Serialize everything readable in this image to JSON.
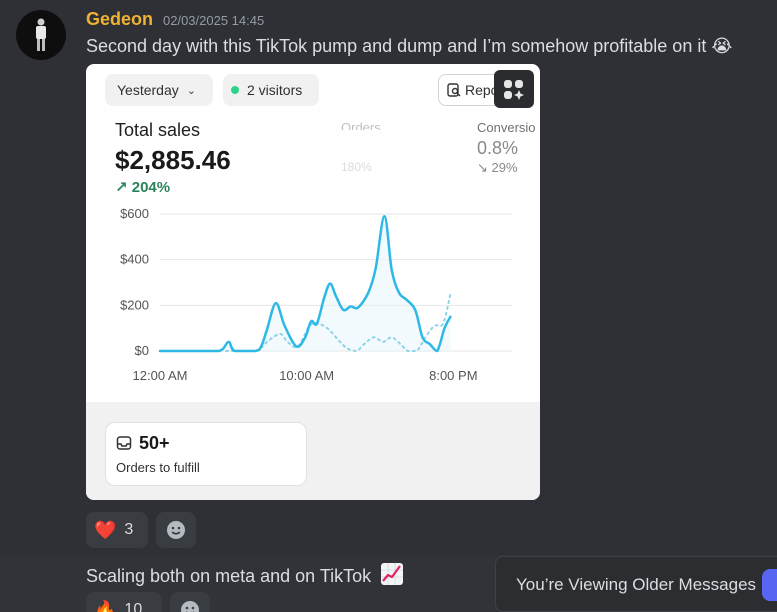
{
  "message1": {
    "author": "Gedeon",
    "timestamp": "02/03/2025 14:45",
    "text": "Second day with this TikTok pump and dump and I’m somehow profitable on it",
    "emoji": "😭"
  },
  "attachment": {
    "date_filter": "Yesterday",
    "visitors": "2 visitors",
    "report_label": "Repo",
    "total_sales_label": "Total sales",
    "total_sales_value": "$2,885.46",
    "total_sales_change": "204%",
    "orders_label": "Orders",
    "orders_change": "180%",
    "conversion_label": "Conversio",
    "conversion_value": "0.8%",
    "conversion_change": "29%",
    "fulfill_count": "50+",
    "fulfill_label": "Orders to fulfill",
    "accent_green": "#29845a",
    "line_color": "#2eb8e6"
  },
  "chart_data": {
    "type": "line",
    "title": "",
    "x_ticks": [
      "12:00 AM",
      "10:00 AM",
      "8:00 PM"
    ],
    "y_ticks": [
      "$600",
      "$400",
      "$200",
      "$0"
    ],
    "ylim": [
      0,
      600
    ],
    "series": [
      {
        "name": "",
        "style": "solid",
        "x": [
          0,
          1,
          2,
          3,
          4,
          5,
          6,
          7,
          8,
          9,
          10,
          11,
          12,
          13,
          14,
          15,
          16,
          17,
          18,
          19,
          20,
          21,
          22,
          23,
          24
        ],
        "values": [
          0,
          0,
          0,
          0,
          0,
          0,
          0,
          0,
          0,
          0,
          0,
          0,
          0,
          0,
          0,
          0,
          0,
          0,
          0,
          0,
          0,
          0,
          0,
          0,
          0
        ]
      }
    ],
    "solid_points": [
      [
        0,
        0
      ],
      [
        3,
        0
      ],
      [
        4,
        0
      ],
      [
        4.3,
        10
      ],
      [
        4.7,
        40
      ],
      [
        5.1,
        0
      ],
      [
        6.5,
        0
      ],
      [
        6.9,
        20
      ],
      [
        7.3,
        95
      ],
      [
        7.9,
        210
      ],
      [
        8.5,
        110
      ],
      [
        9.3,
        20
      ],
      [
        9.9,
        60
      ],
      [
        10.3,
        130
      ],
      [
        10.7,
        120
      ],
      [
        11.2,
        235
      ],
      [
        11.6,
        295
      ],
      [
        12.0,
        240
      ],
      [
        12.5,
        180
      ],
      [
        13.0,
        195
      ],
      [
        13.5,
        190
      ],
      [
        14.2,
        255
      ],
      [
        14.7,
        360
      ],
      [
        15.3,
        590
      ],
      [
        15.8,
        355
      ],
      [
        16.3,
        255
      ],
      [
        16.8,
        225
      ],
      [
        17.4,
        180
      ],
      [
        17.9,
        60
      ],
      [
        18.4,
        30
      ],
      [
        18.9,
        0
      ],
      [
        19.4,
        100
      ],
      [
        19.8,
        150
      ]
    ],
    "dotted_points": [
      [
        4.5,
        0
      ],
      [
        6.3,
        0
      ],
      [
        6.9,
        15
      ],
      [
        7.4,
        45
      ],
      [
        8.2,
        75
      ],
      [
        8.7,
        40
      ],
      [
        9.4,
        20
      ],
      [
        10.2,
        110
      ],
      [
        10.8,
        120
      ],
      [
        11.5,
        95
      ],
      [
        12.2,
        45
      ],
      [
        12.8,
        10
      ],
      [
        13.4,
        0
      ],
      [
        14.0,
        35
      ],
      [
        14.6,
        60
      ],
      [
        15.2,
        40
      ],
      [
        15.8,
        60
      ],
      [
        16.4,
        30
      ],
      [
        16.9,
        0
      ],
      [
        17.5,
        0
      ],
      [
        18.1,
        60
      ],
      [
        18.7,
        110
      ],
      [
        19.3,
        120
      ],
      [
        19.8,
        250
      ]
    ]
  },
  "reactions1": [
    {
      "emoji": "❤️",
      "count": "3"
    }
  ],
  "message2": {
    "text": "Scaling both on meta and on TikTok"
  },
  "reactions2": [
    {
      "emoji": "🔥",
      "count": "10"
    }
  ],
  "older_banner": {
    "text": "You’re Viewing Older Messages"
  }
}
